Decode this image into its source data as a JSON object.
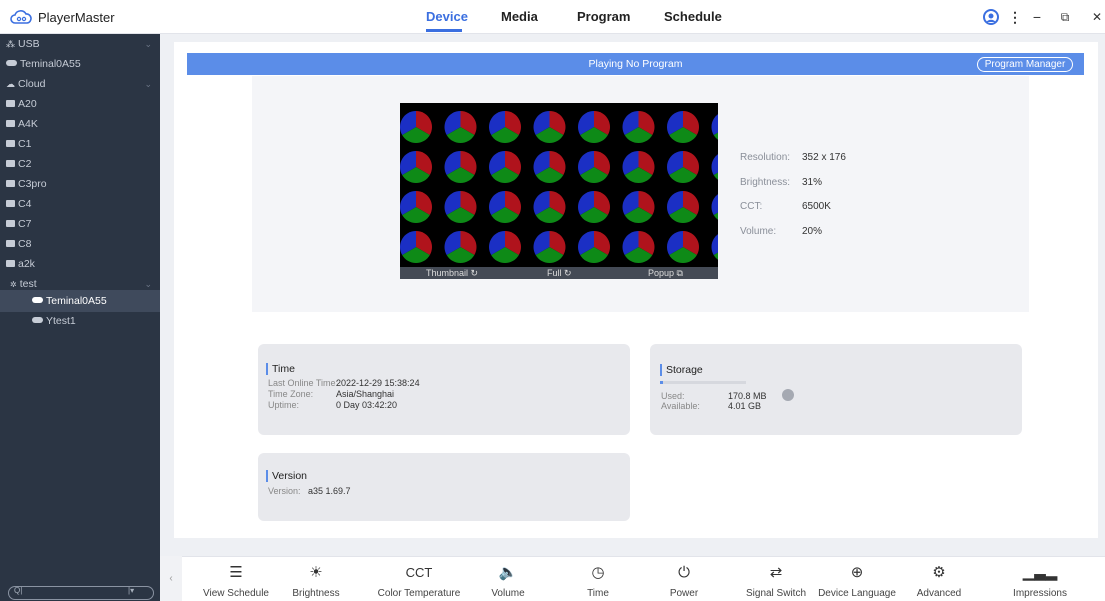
{
  "app": {
    "title": "PlayerMaster"
  },
  "nav": {
    "tabs": [
      {
        "label": "Device",
        "active": true
      },
      {
        "label": "Media"
      },
      {
        "label": "Program"
      },
      {
        "label": "Schedule"
      }
    ]
  },
  "window_controls": {
    "user_icon": "user-icon",
    "menu_icon": "more-vertical-icon",
    "minimize": "−",
    "restore": "⧉",
    "close": "✕"
  },
  "sidebar": {
    "items": [
      {
        "label": "USB",
        "level": 0,
        "icon": "usb-icon",
        "expandable": true
      },
      {
        "label": "Teminal0A55",
        "level": 1,
        "icon": "device-icon"
      },
      {
        "label": "Cloud",
        "level": 0,
        "icon": "cloud-icon",
        "expandable": true
      },
      {
        "label": "A20",
        "level": 1,
        "icon": "group-icon"
      },
      {
        "label": "A4K",
        "level": 1,
        "icon": "group-icon"
      },
      {
        "label": "C1",
        "level": 1,
        "icon": "group-icon"
      },
      {
        "label": "C2",
        "level": 1,
        "icon": "group-icon"
      },
      {
        "label": "C3pro",
        "level": 1,
        "icon": "group-icon"
      },
      {
        "label": "C4",
        "level": 1,
        "icon": "group-icon"
      },
      {
        "label": "C7",
        "level": 1,
        "icon": "group-icon"
      },
      {
        "label": "C8",
        "level": 1,
        "icon": "group-icon"
      },
      {
        "label": "a2k",
        "level": 1,
        "icon": "group-icon"
      },
      {
        "label": "test",
        "level": 1,
        "icon": "group-icon",
        "expandable": true
      },
      {
        "label": "Teminal0A55",
        "level": 2,
        "icon": "device-icon",
        "selected": true
      },
      {
        "label": "Ytest1",
        "level": 2,
        "icon": "device-icon"
      }
    ],
    "search": {
      "placeholder": ""
    }
  },
  "banner": {
    "status": "Playing No Program",
    "program_manager": "Program Manager"
  },
  "preview": {
    "buttons": {
      "thumbnail": "Thumbnail",
      "full": "Full",
      "popup": "Popup"
    },
    "colors": {
      "red": "#b0131c",
      "green": "#0e8a17",
      "blue": "#1b2fc4"
    }
  },
  "device_info": {
    "resolution_label": "Resolution:",
    "resolution": "352 x 176",
    "brightness_label": "Brightness:",
    "brightness": "31%",
    "cct_label": "CCT:",
    "cct": "6500K",
    "volume_label": "Volume:",
    "volume": "20%"
  },
  "time_card": {
    "title": "Time",
    "last_online_label": "Last Online Time:",
    "last_online": "2022-12-29 15:38:24",
    "timezone_label": "Time Zone:",
    "timezone": "Asia/Shanghai",
    "uptime_label": "Uptime:",
    "uptime": "0 Day 03:42:20"
  },
  "storage_card": {
    "title": "Storage",
    "used_label": "Used:",
    "used": "170.8 MB",
    "available_label": "Available:",
    "available": "4.01 GB",
    "used_fraction": 0.04
  },
  "version_card": {
    "title": "Version",
    "version_label": "Version:",
    "version": "a35 1.69.7"
  },
  "toolbar": {
    "items": [
      {
        "label": "View Schedule",
        "icon": "list-search-icon"
      },
      {
        "label": "Brightness",
        "icon": "sun-icon"
      },
      {
        "label": "Color Temperature",
        "icon": "cct-icon",
        "glyph": "CCT"
      },
      {
        "label": "Volume",
        "icon": "speaker-icon"
      },
      {
        "label": "Time",
        "icon": "clock-icon"
      },
      {
        "label": "Power",
        "icon": "power-icon"
      },
      {
        "label": "Signal Switch",
        "icon": "swap-arrows-icon"
      },
      {
        "label": "Device Language",
        "icon": "globe-icon"
      },
      {
        "label": "Advanced",
        "icon": "gear-icon"
      },
      {
        "label": "Impressions",
        "icon": "bar-chart-icon"
      }
    ]
  },
  "theme": {
    "accent": "#3b6fe0",
    "banner": "#5b8de8",
    "sidebar_bg": "#2b3544"
  }
}
